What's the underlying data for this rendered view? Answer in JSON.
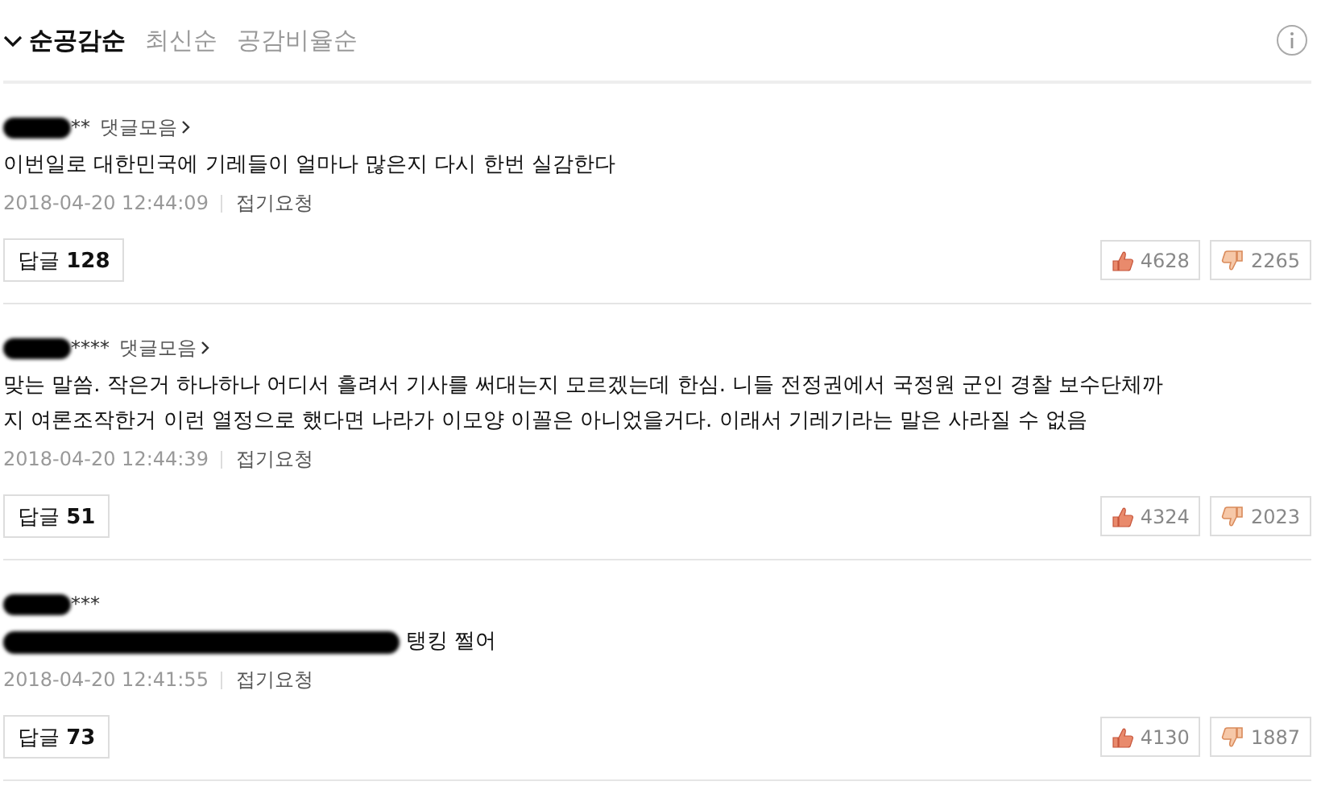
{
  "sort_tabs": [
    {
      "label": "순공감순",
      "selected": true
    },
    {
      "label": "최신순",
      "selected": false
    },
    {
      "label": "공감비율순",
      "selected": false
    }
  ],
  "comments": [
    {
      "author": {
        "redacted": true,
        "visible": "**"
      },
      "collection_link": "댓글모음",
      "text_redacted": false,
      "text": [
        "이번일로 대한민국에 기레들이 얼마나 많은지 다시 한번 실감한다"
      ],
      "time": "2018-04-20 12:44:09",
      "fold": "접기요청",
      "reply_label": "답글",
      "reply_count": "128",
      "likes": "4628",
      "dislikes": "2265"
    },
    {
      "author": {
        "redacted": true,
        "visible": "****"
      },
      "collection_link": "댓글모음",
      "text_redacted": false,
      "text": [
        "맞는 말씀. 작은거 하나하나 어디서 흘려서 기사를 써대는지 모르겠는데 한심. 니들 전정권에서 국정원 군인 경찰 보수단체까",
        "지 여론조작한거 이런 열정으로 했다면 나라가 이모양 이꼴은 아니었을거다. 이래서 기레기라는 말은 사라질 수 없음"
      ],
      "time": "2018-04-20 12:44:39",
      "fold": "접기요청",
      "reply_label": "답글",
      "reply_count": "51",
      "likes": "4324",
      "dislikes": "2023"
    },
    {
      "author": {
        "redacted": true,
        "visible": "***"
      },
      "text_redacted": true,
      "text": [
        "탱킹 쩔어"
      ],
      "time": "2018-04-20 12:41:55",
      "fold": "접기요청",
      "reply_label": "답글",
      "reply_count": "73",
      "likes": "4130",
      "dislikes": "1887"
    }
  ]
}
